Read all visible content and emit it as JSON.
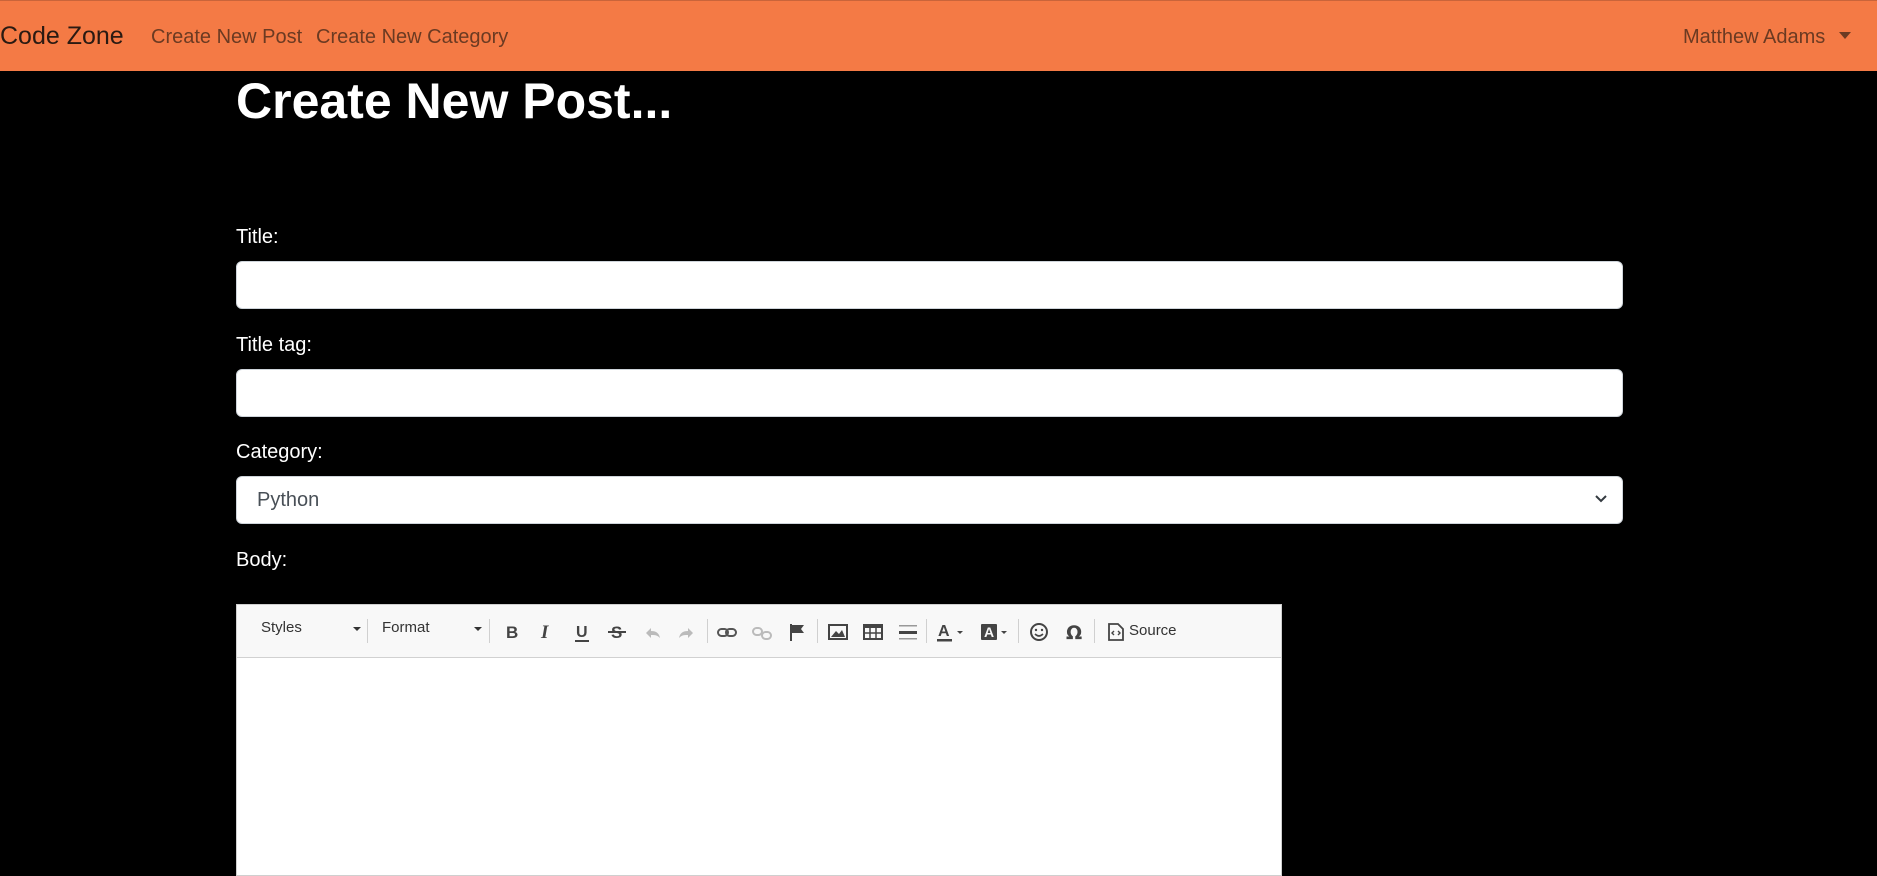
{
  "navbar": {
    "brand": "Code Zone",
    "links": [
      "Create New Post",
      "Create New Category"
    ],
    "user": "Matthew Adams",
    "color": "#f47a45"
  },
  "page": {
    "title": "Create New Post..."
  },
  "form": {
    "title_label": "Title:",
    "title_value": "",
    "title_tag_label": "Title tag:",
    "title_tag_value": "",
    "category_label": "Category:",
    "category_value": "Python",
    "body_label": "Body:"
  },
  "editor": {
    "styles_label": "Styles",
    "format_label": "Format",
    "source_label": "Source",
    "buttons": [
      "bold-icon",
      "italic-icon",
      "underline-icon",
      "strikethrough-icon",
      "undo-icon",
      "redo-icon",
      "link-icon",
      "unlink-icon",
      "anchor-flag-icon",
      "image-icon",
      "table-icon",
      "horizontal-line-icon",
      "text-color-icon",
      "background-color-icon",
      "emoji-icon",
      "special-char-omega-icon",
      "source-code-icon"
    ]
  }
}
